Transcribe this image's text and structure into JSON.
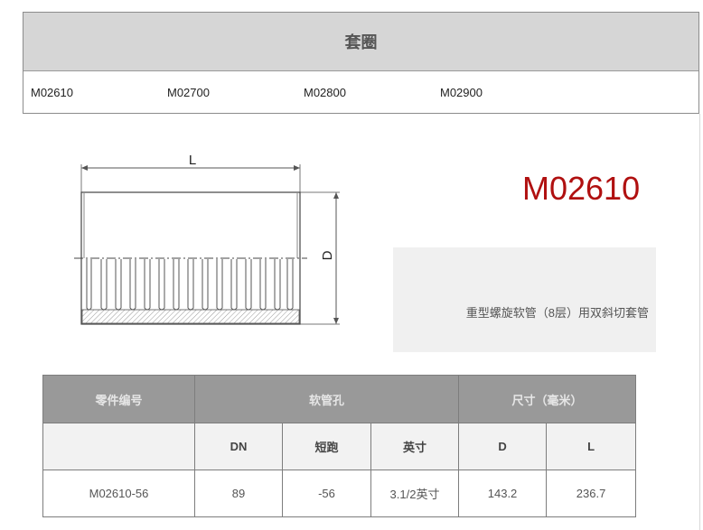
{
  "category": {
    "title": "套圈",
    "links": [
      "M02610",
      "M02700",
      "M02800",
      "M02900"
    ]
  },
  "drawing": {
    "length_label": "L",
    "diameter_label": "D"
  },
  "product": {
    "part_number": "M02610",
    "description": "重型螺旋软管（8层）用双斜切套管"
  },
  "table": {
    "group_headers": [
      "零件编号",
      "软管孔",
      "尺寸（毫米）"
    ],
    "sub_headers": [
      "",
      "DN",
      "短跑",
      "英寸",
      "D",
      "L"
    ],
    "rows": [
      [
        "M02610-56",
        "89",
        "-56",
        "3.1/2英寸",
        "143.2",
        "236.7"
      ]
    ]
  },
  "colors": {
    "part_title": "#b01010",
    "header_bar": "#d6d6d6",
    "table_header": "#999999"
  }
}
